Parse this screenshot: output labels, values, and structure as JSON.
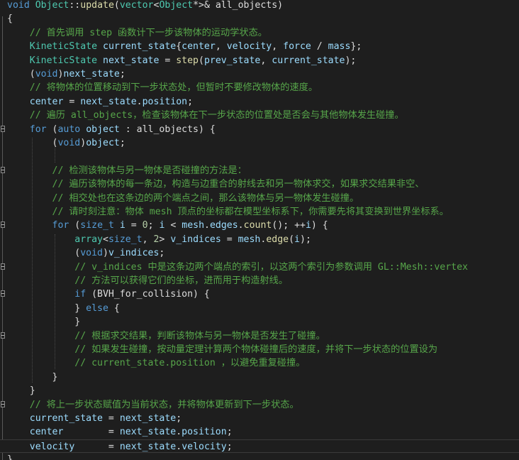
{
  "editor": {
    "language": "C++",
    "theme_colors": {
      "background": "#1e1e1e",
      "keyword": "#569cd6",
      "type": "#4ec9b0",
      "function": "#dcdcaa",
      "variable": "#9cdcfe",
      "number": "#b5cea8",
      "comment": "#57a64a",
      "plain": "#dcdcdc"
    },
    "current_line": 32,
    "lines": [
      {
        "fold": false,
        "tokens": [
          [
            "kw",
            "void"
          ],
          [
            "p",
            " "
          ],
          [
            "type",
            "Object"
          ],
          [
            "p",
            "::"
          ],
          [
            "fn",
            "update"
          ],
          [
            "p",
            "("
          ],
          [
            "type",
            "vector"
          ],
          [
            "p",
            "<"
          ],
          [
            "type",
            "Object"
          ],
          [
            "p",
            "*>& all_objects)"
          ]
        ]
      },
      {
        "fold": false,
        "tokens": [
          [
            "p",
            "{"
          ]
        ]
      },
      {
        "fold": false,
        "tokens": [
          [
            "p",
            "    "
          ],
          [
            "cm",
            "// 首先调用 step 函数计下一步该物体的运动学状态。"
          ]
        ]
      },
      {
        "fold": false,
        "tokens": [
          [
            "p",
            "    "
          ],
          [
            "type",
            "KineticState"
          ],
          [
            "p",
            " "
          ],
          [
            "var",
            "current_state"
          ],
          [
            "p",
            "{"
          ],
          [
            "var",
            "center"
          ],
          [
            "p",
            ", "
          ],
          [
            "var",
            "velocity"
          ],
          [
            "p",
            ", "
          ],
          [
            "var",
            "force"
          ],
          [
            "p",
            " / "
          ],
          [
            "var",
            "mass"
          ],
          [
            "p",
            "};"
          ]
        ]
      },
      {
        "fold": false,
        "tokens": [
          [
            "p",
            "    "
          ],
          [
            "type",
            "KineticState"
          ],
          [
            "p",
            " "
          ],
          [
            "var",
            "next_state"
          ],
          [
            "p",
            " = "
          ],
          [
            "fn",
            "step"
          ],
          [
            "p",
            "("
          ],
          [
            "var",
            "prev_state"
          ],
          [
            "p",
            ", "
          ],
          [
            "var",
            "current_state"
          ],
          [
            "p",
            ");"
          ]
        ]
      },
      {
        "fold": false,
        "tokens": [
          [
            "p",
            "    ("
          ],
          [
            "kw",
            "void"
          ],
          [
            "p",
            ")"
          ],
          [
            "var",
            "next_state"
          ],
          [
            "p",
            ";"
          ]
        ]
      },
      {
        "fold": false,
        "tokens": [
          [
            "p",
            "    "
          ],
          [
            "cm",
            "// 将物体的位置移动到下一步状态处，但暂时不要修改物体的速度。"
          ]
        ]
      },
      {
        "fold": false,
        "tokens": [
          [
            "p",
            "    "
          ],
          [
            "var",
            "center"
          ],
          [
            "p",
            " = "
          ],
          [
            "var",
            "next_state"
          ],
          [
            "p",
            "."
          ],
          [
            "var",
            "position"
          ],
          [
            "p",
            ";"
          ]
        ]
      },
      {
        "fold": false,
        "tokens": [
          [
            "p",
            "    "
          ],
          [
            "cm",
            "// 遍历 all_objects，检查该物体在下一步状态的位置处是否会与其他物体发生碰撞。"
          ]
        ]
      },
      {
        "fold": true,
        "tokens": [
          [
            "p",
            "    "
          ],
          [
            "kw",
            "for"
          ],
          [
            "p",
            " ("
          ],
          [
            "kw",
            "auto"
          ],
          [
            "p",
            " "
          ],
          [
            "var",
            "object"
          ],
          [
            "p",
            " : all_objects) {"
          ]
        ]
      },
      {
        "fold": false,
        "tokens": [
          [
            "p",
            "        ("
          ],
          [
            "kw",
            "void"
          ],
          [
            "p",
            ")"
          ],
          [
            "var",
            "object"
          ],
          [
            "p",
            ";"
          ]
        ]
      },
      {
        "fold": false,
        "tokens": [
          [
            "p",
            ""
          ]
        ]
      },
      {
        "fold": true,
        "tokens": [
          [
            "p",
            "        "
          ],
          [
            "cm",
            "// 检测该物体与另一物体是否碰撞的方法是："
          ]
        ]
      },
      {
        "fold": false,
        "tokens": [
          [
            "p",
            "        "
          ],
          [
            "cm",
            "// 遍历该物体的每一条边，构造与边重合的射线去和另一物体求交，如果求交结果非空、"
          ]
        ]
      },
      {
        "fold": false,
        "tokens": [
          [
            "p",
            "        "
          ],
          [
            "cm",
            "// 相交处也在这条边的两个端点之间，那么该物体与另一物体发生碰撞。"
          ]
        ]
      },
      {
        "fold": false,
        "tokens": [
          [
            "p",
            "        "
          ],
          [
            "cm",
            "// 请时刻注意：物体 mesh 顶点的坐标都在模型坐标系下，你需要先将其变换到世界坐标系。"
          ]
        ]
      },
      {
        "fold": true,
        "tokens": [
          [
            "p",
            "        "
          ],
          [
            "kw",
            "for"
          ],
          [
            "p",
            " ("
          ],
          [
            "kw",
            "size_t"
          ],
          [
            "p",
            " "
          ],
          [
            "var",
            "i"
          ],
          [
            "p",
            " = "
          ],
          [
            "num",
            "0"
          ],
          [
            "p",
            "; "
          ],
          [
            "var",
            "i"
          ],
          [
            "p",
            " < "
          ],
          [
            "var",
            "mesh"
          ],
          [
            "p",
            "."
          ],
          [
            "var",
            "edges"
          ],
          [
            "p",
            "."
          ],
          [
            "fn",
            "count"
          ],
          [
            "p",
            "(); ++"
          ],
          [
            "var",
            "i"
          ],
          [
            "p",
            ") {"
          ]
        ]
      },
      {
        "fold": false,
        "tokens": [
          [
            "p",
            "            "
          ],
          [
            "type",
            "array"
          ],
          [
            "p",
            "<"
          ],
          [
            "kw",
            "size_t"
          ],
          [
            "p",
            ", "
          ],
          [
            "num",
            "2"
          ],
          [
            "p",
            "> "
          ],
          [
            "var",
            "v_indices"
          ],
          [
            "p",
            " = "
          ],
          [
            "var",
            "mesh"
          ],
          [
            "p",
            "."
          ],
          [
            "fn",
            "edge"
          ],
          [
            "p",
            "("
          ],
          [
            "var",
            "i"
          ],
          [
            "p",
            ");"
          ]
        ]
      },
      {
        "fold": false,
        "tokens": [
          [
            "p",
            "            ("
          ],
          [
            "kw",
            "void"
          ],
          [
            "p",
            ")"
          ],
          [
            "var",
            "v_indices"
          ],
          [
            "p",
            ";"
          ]
        ]
      },
      {
        "fold": true,
        "tokens": [
          [
            "p",
            "            "
          ],
          [
            "cm",
            "// v_indices 中是这条边两个端点的索引，以这两个索引为参数调用 GL::Mesh::vertex"
          ]
        ]
      },
      {
        "fold": false,
        "tokens": [
          [
            "p",
            "            "
          ],
          [
            "cm",
            "// 方法可以获得它们的坐标，进而用于构造射线。"
          ]
        ]
      },
      {
        "fold": true,
        "tokens": [
          [
            "p",
            "            "
          ],
          [
            "kw",
            "if"
          ],
          [
            "p",
            " (BVH_for_collision) {"
          ]
        ]
      },
      {
        "fold": false,
        "tokens": [
          [
            "p",
            "            } "
          ],
          [
            "kw",
            "else"
          ],
          [
            "p",
            " {"
          ]
        ]
      },
      {
        "fold": false,
        "tokens": [
          [
            "p",
            "            }"
          ]
        ]
      },
      {
        "fold": true,
        "tokens": [
          [
            "p",
            "            "
          ],
          [
            "cm",
            "// 根据求交结果，判断该物体与另一物体是否发生了碰撞。"
          ]
        ]
      },
      {
        "fold": false,
        "tokens": [
          [
            "p",
            "            "
          ],
          [
            "cm",
            "// 如果发生碰撞，按动量定理计算两个物体碰撞后的速度，并将下一步状态的位置设为"
          ]
        ]
      },
      {
        "fold": false,
        "tokens": [
          [
            "p",
            "            "
          ],
          [
            "cm",
            "// current_state.position ，以避免重复碰撞。"
          ]
        ]
      },
      {
        "fold": false,
        "tokens": [
          [
            "p",
            "        }"
          ]
        ]
      },
      {
        "fold": false,
        "tokens": [
          [
            "p",
            "    }"
          ]
        ]
      },
      {
        "fold": true,
        "tokens": [
          [
            "p",
            "    "
          ],
          [
            "cm",
            "// 将上一步状态赋值为当前状态，并将物体更新到下一步状态。"
          ]
        ]
      },
      {
        "fold": false,
        "tokens": [
          [
            "p",
            "    "
          ],
          [
            "var",
            "current_state"
          ],
          [
            "p",
            " = "
          ],
          [
            "var",
            "next_state"
          ],
          [
            "p",
            ";"
          ]
        ]
      },
      {
        "fold": false,
        "tokens": [
          [
            "p",
            "    "
          ],
          [
            "var",
            "center"
          ],
          [
            "p",
            "        = "
          ],
          [
            "var",
            "next_state"
          ],
          [
            "p",
            "."
          ],
          [
            "var",
            "position"
          ],
          [
            "p",
            ";"
          ]
        ]
      },
      {
        "fold": false,
        "tokens": [
          [
            "p",
            "    "
          ],
          [
            "var",
            "velocity"
          ],
          [
            "p",
            "      = "
          ],
          [
            "var",
            "next_state"
          ],
          [
            "p",
            "."
          ],
          [
            "var",
            "velocity"
          ],
          [
            "p",
            ";"
          ]
        ]
      },
      {
        "fold": false,
        "tokens": [
          [
            "p",
            "}"
          ]
        ]
      }
    ]
  }
}
